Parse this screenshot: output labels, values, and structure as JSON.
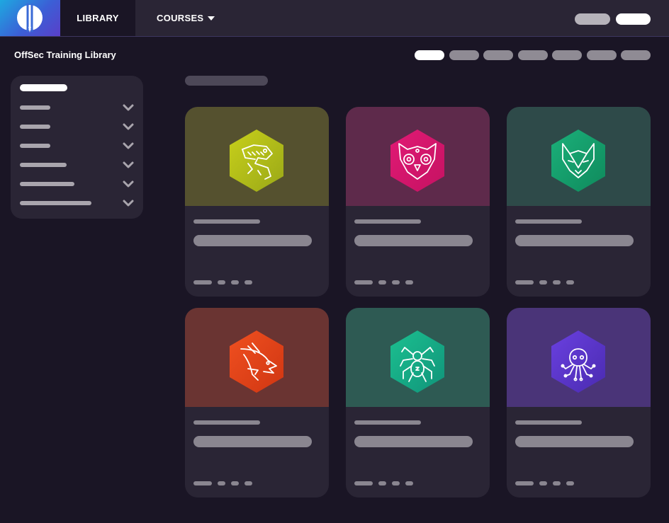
{
  "nav": {
    "library_label": "LIBRARY",
    "courses_label": "COURSES"
  },
  "page": {
    "title": "OffSec Training Library"
  },
  "colors": {
    "background": "#1a1525",
    "topbar": "#2a2535",
    "accent_gradient": [
      "#1ea8e0",
      "#5a3fc9"
    ]
  },
  "cards": [
    {
      "name": "card-viper",
      "icon": "viper-icon",
      "top_color": "#55512f",
      "hex_color": "#b8c41c"
    },
    {
      "name": "card-owl",
      "icon": "owl-icon",
      "top_color": "#5e2a4b",
      "hex_color": "#d6176b"
    },
    {
      "name": "card-fox",
      "icon": "fox-icon",
      "top_color": "#2e4a49",
      "hex_color": "#17a06c"
    },
    {
      "name": "card-dragon",
      "icon": "dragon-icon",
      "top_color": "#6a3432",
      "hex_color": "#e04318"
    },
    {
      "name": "card-spider",
      "icon": "spider-icon",
      "top_color": "#2e5a53",
      "hex_color": "#16b085"
    },
    {
      "name": "card-octopus",
      "icon": "octopus-icon",
      "top_color": "#4a3478",
      "hex_color": "#5a32c8"
    }
  ]
}
